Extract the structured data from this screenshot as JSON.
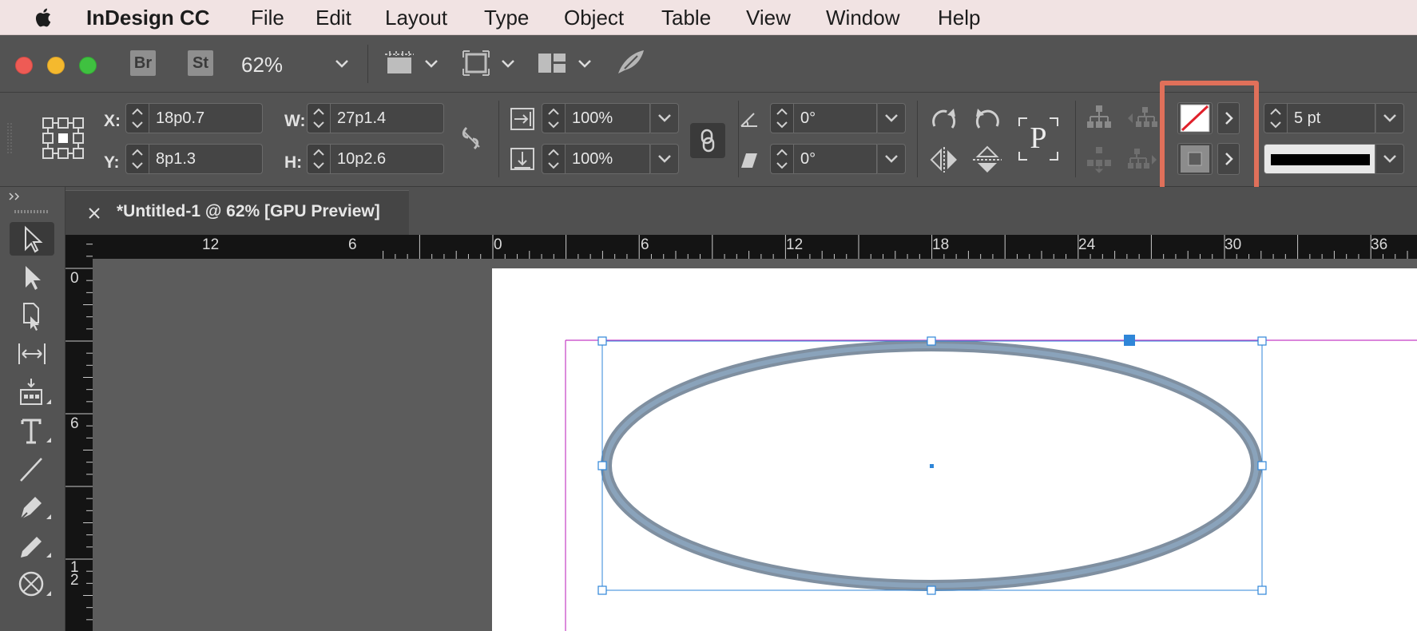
{
  "menubar": {
    "app_name": "InDesign CC",
    "items": [
      "File",
      "Edit",
      "Layout",
      "Type",
      "Object",
      "Table",
      "View",
      "Window",
      "Help"
    ]
  },
  "appbar": {
    "bridge_label": "Br",
    "stock_label": "St",
    "zoom": "62%"
  },
  "control": {
    "x_label": "X:",
    "y_label": "Y:",
    "w_label": "W:",
    "h_label": "H:",
    "x_value": "18p0.7",
    "y_value": "8p1.3",
    "w_value": "27p1.4",
    "h_value": "10p2.6",
    "scale_x": "100%",
    "scale_y": "100%",
    "rotate": "0°",
    "shear": "0°",
    "stroke_weight": "5 pt",
    "frame_type_label": "P"
  },
  "colors": {
    "accent_highlight": "#e0705a",
    "selection_blue": "#2f86d8",
    "ellipse_stroke": "#7f96ac",
    "margin_magenta": "#c53fc5"
  },
  "document": {
    "tab_title": "*Untitled-1 @ 62% [GPU Preview]"
  },
  "rulers": {
    "horizontal": [
      "12",
      "6",
      "0",
      "6",
      "12",
      "18",
      "24",
      "30",
      "36"
    ],
    "vertical": [
      "0",
      "6",
      "1",
      "2"
    ]
  }
}
